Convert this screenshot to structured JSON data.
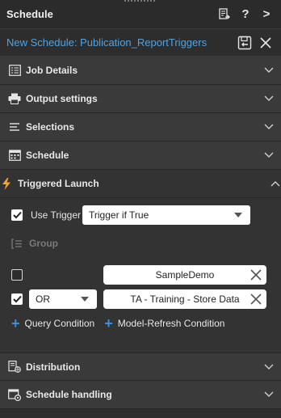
{
  "header": {
    "title": "Schedule",
    "help_label": "?",
    "more_label": ">"
  },
  "schedule": {
    "name": "New Schedule: Publication_ReportTriggers"
  },
  "sections": [
    {
      "label": "Job Details",
      "icon": "job-details-icon"
    },
    {
      "label": "Output settings",
      "icon": "printer-icon"
    },
    {
      "label": "Selections",
      "icon": "list-icon"
    },
    {
      "label": "Schedule",
      "icon": "calendar-icon"
    },
    {
      "label": "Triggered Launch",
      "icon": "lightning-icon"
    },
    {
      "label": "Distribution",
      "icon": "distribution-icon"
    },
    {
      "label": "Schedule handling",
      "icon": "schedule-handling-icon"
    }
  ],
  "trigger": {
    "use_trigger_label": "Use Trigger",
    "use_trigger_checked": true,
    "mode_value": "Trigger if True",
    "group_label": "Group",
    "conditions": [
      {
        "checked": false,
        "operator": "",
        "value": "SampleDemo"
      },
      {
        "checked": true,
        "operator": "OR",
        "value": "TA - Training - Store Data"
      }
    ],
    "add_query_label": "Query Condition",
    "add_model_label": "Model-Refresh Condition"
  },
  "colors": {
    "accent": "#4ea3e6",
    "plus": "#3b8fe0",
    "section_bg": "#3a3a3a",
    "panel_bg": "#2d2d2d"
  }
}
